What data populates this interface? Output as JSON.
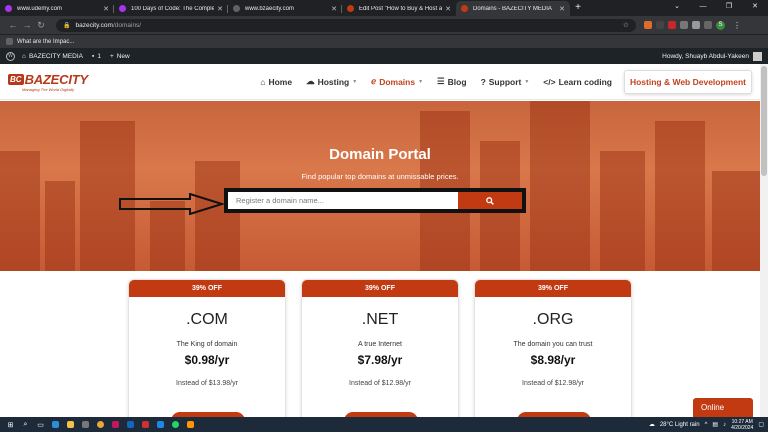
{
  "browser": {
    "tabs": [
      {
        "title": "www.udemy.com",
        "color": "#a435f0"
      },
      {
        "title": "100 Days of Code: The Complete",
        "color": "#a435f0"
      },
      {
        "title": "www.bzaecity.com",
        "color": "#5f6368"
      },
      {
        "title": "Edit Post \"How to Buy & Host a",
        "color": "#c23a12"
      },
      {
        "title": "Domains - BAZECITY MEDIA",
        "color": "#c23a12"
      }
    ],
    "new_tab": "+",
    "url_host": "bazecity.com",
    "url_path": "/domains/",
    "bookmark": "What are the Impac..."
  },
  "wpadmin": {
    "site_name": "BAZECITY MEDIA",
    "comments_count": "1",
    "new_label": "New",
    "howdy": "Howdy, Shuayb Abdul-Yakeen"
  },
  "site": {
    "logo_mark": "BC",
    "logo_name": "BAZECITY",
    "logo_tagline": "Managing The World Digitally",
    "nav": [
      {
        "label": "Home",
        "icon": "home-icon"
      },
      {
        "label": "Hosting",
        "icon": "cloud-icon"
      },
      {
        "label": "Domains",
        "icon": "e-icon"
      },
      {
        "label": "Blog",
        "icon": "rss-icon"
      },
      {
        "label": "Support",
        "icon": "question-icon"
      },
      {
        "label": "Learn coding",
        "icon": "code-icon"
      }
    ],
    "cta": "Hosting & Web Development"
  },
  "hero": {
    "title": "Domain Portal",
    "subtitle": "Find popular top domains at unmissable prices.",
    "search_placeholder": "Register a domain name..."
  },
  "cards": [
    {
      "badge": "39% OFF",
      "tld": ".COM",
      "desc": "The King of domain",
      "price": "$0.98/yr",
      "old": "Instead of $13.98/yr"
    },
    {
      "badge": "39% OFF",
      "tld": ".NET",
      "desc": "A true Internet",
      "price": "$7.98/yr",
      "old": "Instead of $12.98/yr"
    },
    {
      "badge": "39% OFF",
      "tld": ".ORG",
      "desc": "The domain you can trust",
      "price": "$8.98/yr",
      "old": "Instead of $12.98/yr"
    }
  ],
  "chat": {
    "label": "Online"
  },
  "taskbar": {
    "weather": "28°C  Light rain",
    "time": "10:27 AM",
    "date": "4/20/2024"
  },
  "colors": {
    "brand": "#c23a12"
  }
}
